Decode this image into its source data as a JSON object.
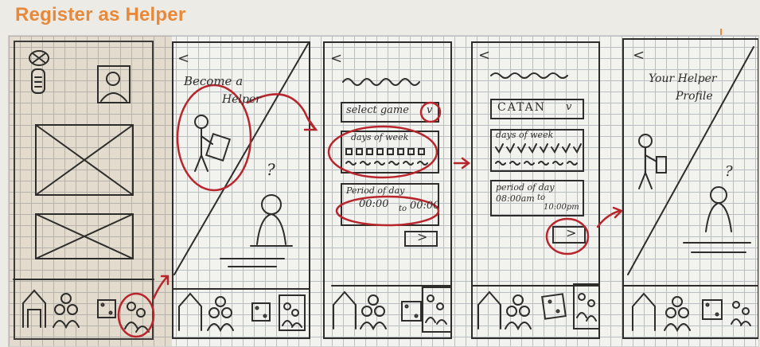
{
  "page": {
    "title": "Register as Helper"
  },
  "sketch1": {
    "nav": [
      "home-icon",
      "people-icon",
      "dice-icon",
      "helper-icon"
    ]
  },
  "sketch2": {
    "back": "<",
    "heading_line1": "Become a",
    "heading_line2": "Helper",
    "question": "?"
  },
  "sketch3": {
    "back": "<",
    "select_label": "select game",
    "select_caret": "v",
    "days_label": "days of week",
    "period_label": "Period of day",
    "time_from": "00:00",
    "time_to_word": "to",
    "time_to": "00:00",
    "next": ">"
  },
  "sketch4": {
    "back": "<",
    "game": "CATAN",
    "select_caret": "v",
    "days_label": "days of week",
    "period_label": "period of day",
    "time_from": "08:00am",
    "time_to_word": "to",
    "time_to": "10:00pm",
    "next": ">"
  },
  "sketch5": {
    "back": "<",
    "heading_line1": "Your Helper",
    "heading_line2": "Profile",
    "question": "?"
  },
  "colors": {
    "accent": "#e8893a",
    "ink": "#2f2d2b",
    "marker": "#b8262d"
  }
}
